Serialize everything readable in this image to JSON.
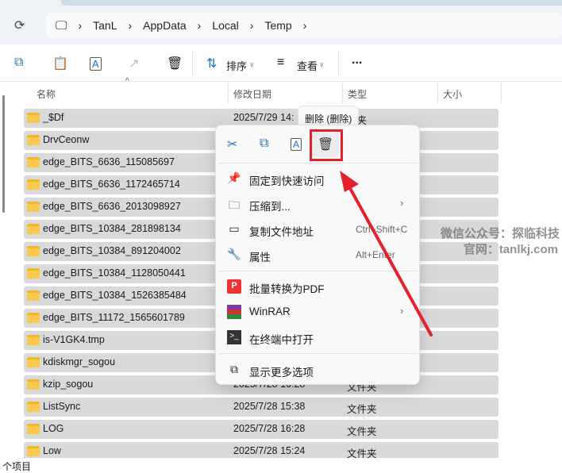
{
  "address": {
    "crumbs": [
      "TanL",
      "AppData",
      "Local",
      "Temp"
    ]
  },
  "toolbar": {
    "sort": "排序",
    "view": "查看",
    "more": "..."
  },
  "columns": {
    "name": "名称",
    "date": "修改日期",
    "type": "类型",
    "size": "大小"
  },
  "files": [
    {
      "name": "_$Df",
      "date": "2025/7/29 14:",
      "type": "件夹"
    },
    {
      "name": "DrvCeonw",
      "date": "",
      "type": ""
    },
    {
      "name": "edge_BITS_6636_115085697",
      "date": "",
      "type": ""
    },
    {
      "name": "edge_BITS_6636_1172465714",
      "date": "",
      "type": ""
    },
    {
      "name": "edge_BITS_6636_2013098927",
      "date": "",
      "type": ""
    },
    {
      "name": "edge_BITS_10384_281898134",
      "date": "",
      "type": ""
    },
    {
      "name": "edge_BITS_10384_891204002",
      "date": "",
      "type": ""
    },
    {
      "name": "edge_BITS_10384_1128050441",
      "date": "",
      "type": ""
    },
    {
      "name": "edge_BITS_10384_1526385484",
      "date": "",
      "type": ""
    },
    {
      "name": "edge_BITS_11172_1565601789",
      "date": "",
      "type": ""
    },
    {
      "name": "is-V1GK4.tmp",
      "date": "",
      "type": ""
    },
    {
      "name": "kdiskmgr_sogou",
      "date": "",
      "type": ""
    },
    {
      "name": "kzip_sogou",
      "date": "2025/7/28 16:28",
      "type": "文件夹"
    },
    {
      "name": "ListSync",
      "date": "2025/7/28 15:38",
      "type": "文件夹"
    },
    {
      "name": "LOG",
      "date": "2025/7/28 16:28",
      "type": "文件夹"
    },
    {
      "name": "Low",
      "date": "2025/7/28 15:24",
      "type": "文件夹"
    }
  ],
  "tooltip": "删除 (删除)",
  "menu": {
    "pin": "固定到快速访问",
    "compress": "压缩到...",
    "copy_path": "复制文件地址",
    "copy_path_shortcut": "Ctrl+Shift+C",
    "properties": "属性",
    "properties_shortcut": "Alt+Enter",
    "pdf": "批量转换为PDF",
    "winrar": "WinRAR",
    "terminal": "在终端中打开",
    "more": "显示更多选项"
  },
  "watermark": {
    "line1": "微信公众号：探临科技",
    "line2": "官网：tanlkj.com"
  },
  "status": "个项目",
  "colors": {
    "accent": "#1f6fc5",
    "annotation": "#e4202a"
  }
}
